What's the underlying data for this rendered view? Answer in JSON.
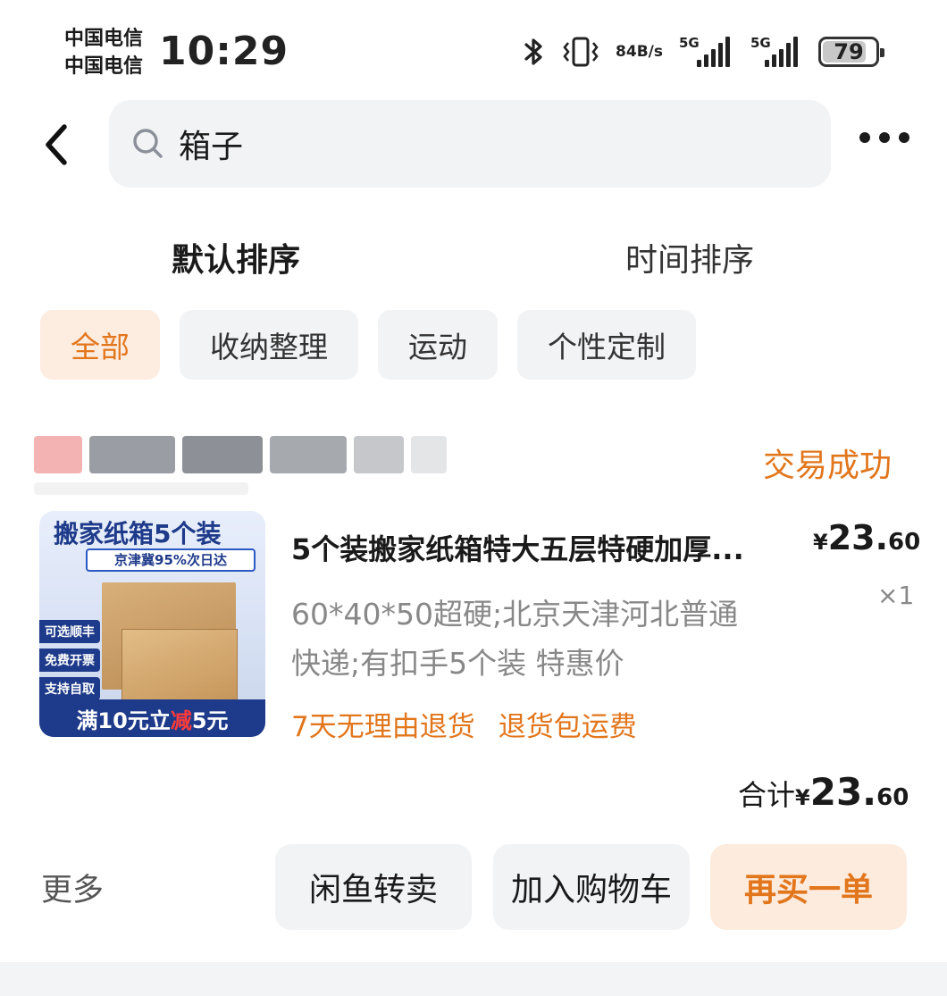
{
  "status_bar": {
    "carrier_1": "中国电信",
    "carrier_2": "中国电信",
    "time": "10:29",
    "net_speed_value": "84",
    "net_speed_unit": "B/s",
    "sim1_network": "5G",
    "sim2_network": "5G",
    "battery": "79"
  },
  "search": {
    "query": "箱子"
  },
  "sort_tabs": [
    {
      "label": "默认排序",
      "active": true
    },
    {
      "label": "时间排序",
      "active": false
    }
  ],
  "filters": [
    {
      "label": "全部",
      "active": true
    },
    {
      "label": "收纳整理",
      "active": false
    },
    {
      "label": "运动",
      "active": false
    },
    {
      "label": "个性定制",
      "active": false
    }
  ],
  "order": {
    "status": "交易成功",
    "thumbnail": {
      "headline": "搬家纸箱5个装",
      "subline": "京津冀95%次日达",
      "tags": [
        "可选顺丰",
        "免费开票",
        "支持自取"
      ],
      "banner_a": "满10元立",
      "banner_b": "减",
      "banner_c": "5元"
    },
    "title": "5个装搬家纸箱特大五层特硬加厚...",
    "price_symbol": "¥",
    "price_int": "23.",
    "price_dec": "60",
    "quantity": "×1",
    "spec_line_1": "60*40*50超硬;北京天津河北普通",
    "spec_line_2": "快递;有扣手5个装 特惠价",
    "services": [
      "7天无理由退货",
      "退货包运费"
    ],
    "total_label": "合计",
    "total_symbol": "¥",
    "total_int": "23.",
    "total_dec": "60"
  },
  "actions": {
    "more": "更多",
    "resell": "闲鱼转卖",
    "add_cart": "加入购物车",
    "buy_again": "再买一单"
  },
  "colors": {
    "accent": "#e2761c",
    "chip_bg": "#f2f3f5",
    "chip_active_bg": "#fdece0"
  }
}
